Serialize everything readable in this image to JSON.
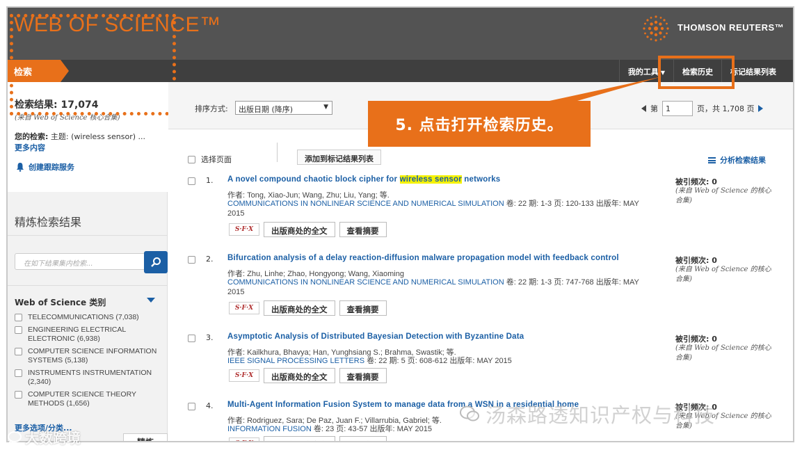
{
  "header": {
    "brand": "WEB OF SCIENCE™",
    "publisher": "THOMSON REUTERS™"
  },
  "nav": {
    "search_tab": "检索",
    "my_tools": "我的工具",
    "search_history": "检索历史",
    "marked_list": "标记结果列表"
  },
  "sidebar": {
    "results_count": "检索结果: 17,074",
    "results_source": "(来自 Web of Science 核心合集)",
    "your_search_label": "您的检索:",
    "your_search_value": "主题: (wireless sensor) ...",
    "more_content": "更多内容",
    "create_alert": "创建跟踪服务",
    "refine_title": "精炼检索结果",
    "refine_placeholder": "在如下结果集内检索...",
    "category_title": "Web of Science 类别",
    "categories": [
      {
        "label": "TELECOMMUNICATIONS (7,038)"
      },
      {
        "label": "ENGINEERING ELECTRICAL ELECTRONIC (6,938)"
      },
      {
        "label": "COMPUTER SCIENCE INFORMATION SYSTEMS (5,138)"
      },
      {
        "label": "INSTRUMENTS INSTRUMENTATION (2,340)"
      },
      {
        "label": "COMPUTER SCIENCE THEORY METHODS (1,656)"
      }
    ],
    "more_options": "更多选项/分类...",
    "refine_button": "精炼"
  },
  "sort_bar": {
    "label": "排序方式:",
    "selected": "出版日期 (降序)",
    "page_prefix": "第",
    "page_value": "1",
    "page_suffix": "页，共 1,708 页"
  },
  "toolbar": {
    "select_page": "选择页面",
    "add_to_marked": "添加到标记结果列表",
    "analyze": "分析检索结果"
  },
  "record_labels": {
    "full_text": "出版商处的全文",
    "view_abstract": "查看摘要",
    "sfx": "S·F·X",
    "times_cited": "被引频次: 0",
    "cited_source": "(来自 Web of Science 的核心合集)"
  },
  "records": [
    {
      "num": "1.",
      "title_before": "A novel compound chaotic block cipher for ",
      "title_highlight": "wireless sensor",
      "title_after": " networks",
      "authors": "作者: Tong, Xiao-Jun; Wang, Zhu; Liu, Yang; 等.",
      "journal": "COMMUNICATIONS IN NONLINEAR SCIENCE AND NUMERICAL SIMULATION",
      "details": " 卷: 22 期: 1-3 页: 120-133 出版年: MAY 2015"
    },
    {
      "num": "2.",
      "title_before": "Bifurcation analysis of a delay reaction-diffusion malware propagation model with feedback control",
      "title_highlight": "",
      "title_after": "",
      "authors": "作者: Zhu, Linhe; Zhao, Hongyong; Wang, Xiaoming",
      "journal": "COMMUNICATIONS IN NONLINEAR SCIENCE AND NUMERICAL SIMULATION",
      "details": " 卷: 22 期: 1-3 页: 747-768 出版年: MAY 2015"
    },
    {
      "num": "3.",
      "title_before": "Asymptotic Analysis of Distributed Bayesian Detection with Byzantine Data",
      "title_highlight": "",
      "title_after": "",
      "authors": "作者: Kailkhura, Bhavya; Han, Yunghsiang S.; Brahma, Swastik; 等.",
      "journal": "IEEE SIGNAL PROCESSING LETTERS",
      "details": " 卷: 22 期: 5 页: 608-612 出版年: MAY 2015"
    },
    {
      "num": "4.",
      "title_before": "Multi-Agent Information Fusion System to manage data from a WSN in a residential home",
      "title_highlight": "",
      "title_after": "",
      "authors": "作者: Rodriguez, Sara; De Paz, Juan F.; Villarrubia, Gabriel; 等.",
      "journal": "INFORMATION FUSION",
      "details": " 卷: 23 页: 43-57 出版年: MAY 2015"
    }
  ],
  "callout": {
    "text": "5.  点击打开检索历史。"
  },
  "watermarks": {
    "left": "大数跨境",
    "right": "汤森路透知识产权与科技"
  },
  "colors": {
    "accent": "#e8701a",
    "header_bg": "#535353",
    "link_blue": "#1b5fa5",
    "highlight": "#f5f200"
  }
}
